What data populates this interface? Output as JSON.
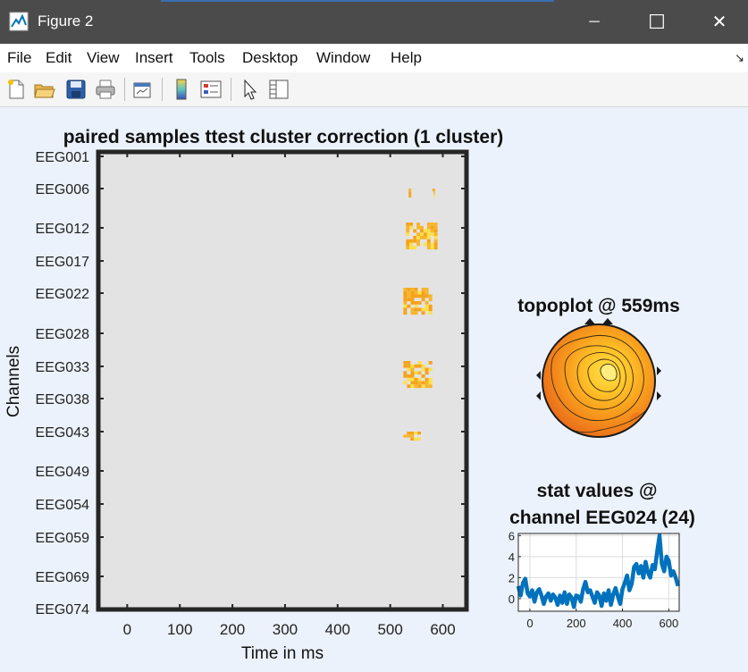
{
  "window": {
    "title": "Figure 2",
    "minimize_glyph": "─",
    "maximize_glyph": "☐",
    "close_glyph": "✕",
    "icon": "matlab-figure-icon"
  },
  "menu": {
    "items": [
      "File",
      "Edit",
      "View",
      "Insert",
      "Tools",
      "Desktop",
      "Window",
      "Help"
    ],
    "dock_glyph": "↘"
  },
  "toolbar": {
    "buttons": [
      "new-figure-icon",
      "open-file-icon",
      "save-icon",
      "print-icon",
      "link-plot-icon",
      "insert-colorbar-icon",
      "insert-legend-icon",
      "edit-plot-icon",
      "property-inspector-icon"
    ]
  },
  "colors": {
    "accent": "#0072bd",
    "axes_bg": "#e3e3e3",
    "figure_bg": "#ecf2fb",
    "cluster": "#f5a31a",
    "cluster_hot": "#ffe04a"
  },
  "chart_data": [
    {
      "type": "heatmap",
      "title": "paired samples ttest cluster correction (1 cluster)",
      "xlabel": "Time in ms",
      "ylabel": "Channels",
      "xlim": [
        -55,
        645
      ],
      "x_ticks": [
        0,
        100,
        200,
        300,
        400,
        500,
        600
      ],
      "y_ticks": [
        "EEG001",
        "EEG006",
        "EEG012",
        "EEG017",
        "EEG022",
        "EEG028",
        "EEG033",
        "EEG038",
        "EEG043",
        "EEG049",
        "EEG054",
        "EEG059",
        "EEG069",
        "EEG074"
      ],
      "cluster_blobs": [
        {
          "t_start": 535,
          "t_end": 545,
          "channel": "EEG006"
        },
        {
          "t_start": 580,
          "t_end": 585,
          "channel": "EEG006"
        },
        {
          "t_start": 530,
          "t_end": 590,
          "channel": "EEG012"
        },
        {
          "t_start": 525,
          "t_end": 580,
          "channel": "EEG022"
        },
        {
          "t_start": 525,
          "t_end": 580,
          "channel": "EEG033"
        },
        {
          "t_start": 525,
          "t_end": 565,
          "channel": "EEG043"
        }
      ]
    },
    {
      "type": "topoplot",
      "title": "topoplot @ 559ms"
    },
    {
      "type": "line",
      "title_line1": "stat values @",
      "title_line2": "channel EEG024 (24)",
      "xlim": [
        -50,
        645
      ],
      "ylim": [
        -1.2,
        6.2
      ],
      "x_ticks": [
        0,
        200,
        400,
        600
      ],
      "y_ticks": [
        0,
        2,
        4,
        6
      ],
      "grid": true,
      "x": [
        -50,
        -40,
        -30,
        -20,
        -10,
        0,
        10,
        20,
        30,
        40,
        50,
        60,
        70,
        80,
        90,
        100,
        110,
        120,
        130,
        140,
        150,
        160,
        170,
        180,
        190,
        200,
        210,
        220,
        230,
        240,
        250,
        260,
        270,
        280,
        290,
        300,
        310,
        320,
        330,
        340,
        350,
        360,
        370,
        380,
        390,
        400,
        410,
        420,
        430,
        440,
        450,
        460,
        470,
        480,
        490,
        500,
        510,
        520,
        530,
        540,
        550,
        560,
        570,
        580,
        590,
        600,
        610,
        620,
        630,
        640
      ],
      "values": [
        1.2,
        0.3,
        1.5,
        1.9,
        0.5,
        0.2,
        0.8,
        -0.3,
        0.6,
        0.9,
        0.3,
        -0.5,
        0.2,
        0.5,
        -0.2,
        0.4,
        0.1,
        -0.6,
        0.3,
        -0.4,
        0.6,
        -0.5,
        0.4,
        0.1,
        -0.8,
        0.3,
        0.2,
        -0.3,
        0.9,
        1.6,
        0.6,
        0.8,
        0.2,
        -0.4,
        0.6,
        0.3,
        -0.7,
        0.5,
        -0.2,
        0.8,
        -0.6,
        0.4,
        1.0,
        0.2,
        -0.5,
        0.9,
        1.5,
        2.2,
        0.8,
        1.4,
        3.0,
        3.3,
        2.4,
        3.1,
        2.0,
        3.5,
        2.5,
        2.0,
        3.2,
        2.8,
        4.5,
        6.0,
        3.3,
        2.6,
        4.0,
        3.6,
        2.2,
        2.6,
        2.0,
        1.2
      ]
    }
  ]
}
